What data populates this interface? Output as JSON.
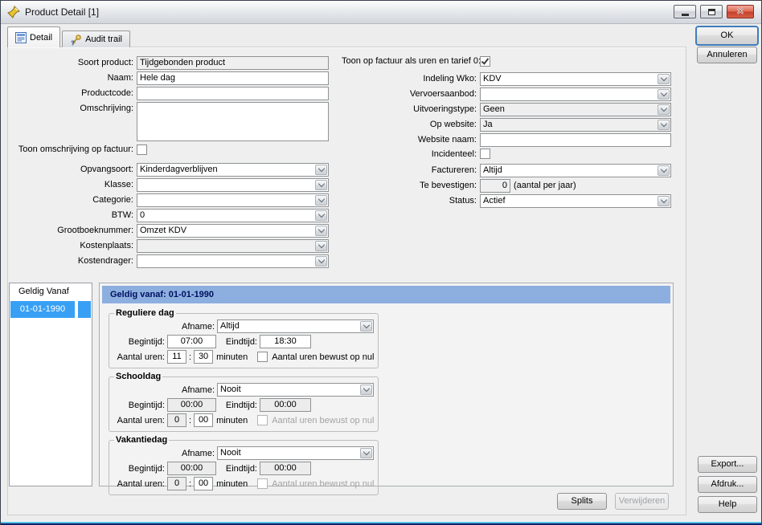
{
  "window": {
    "title": "Product Detail [1]"
  },
  "icons": {
    "titlebar": "pushpin-icon",
    "tab_detail": "document-icon",
    "tab_audit": "audit-key-icon",
    "combo_button": "chevron-down-icon",
    "minimize": "minimize-icon",
    "maximize": "maximize-icon",
    "close": "close-icon"
  },
  "tabs": {
    "detail": "Detail",
    "audit_trail": "Audit trail"
  },
  "buttons": {
    "ok": "OK",
    "annuleren": "Annuleren",
    "export": "Export...",
    "afdruk": "Afdruk...",
    "help": "Help",
    "splits": "Splits",
    "verwijderen": "Verwijderen"
  },
  "form_left": {
    "soort_product": {
      "label": "Soort product:",
      "value": "Tijdgebonden product"
    },
    "naam": {
      "label": "Naam:",
      "value": "Hele dag"
    },
    "productcode": {
      "label": "Productcode:",
      "value": ""
    },
    "omschrijving": {
      "label": "Omschrijving:",
      "value": ""
    },
    "toon_omschrijving": {
      "label": "Toon omschrijving op factuur:",
      "checked": false
    },
    "opvangsoort": {
      "label": "Opvangsoort:",
      "value": "Kinderdagverblijven"
    },
    "klasse": {
      "label": "Klasse:",
      "value": ""
    },
    "categorie": {
      "label": "Categorie:",
      "value": ""
    },
    "btw": {
      "label": "BTW:",
      "value": "0"
    },
    "grootboeknummer": {
      "label": "Grootboeknummer:",
      "value": "Omzet KDV"
    },
    "kostenplaats": {
      "label": "Kostenplaats:",
      "value": ""
    },
    "kostendrager": {
      "label": "Kostendrager:",
      "value": ""
    }
  },
  "form_right": {
    "toon_op_factuur": {
      "label": "Toon op factuur als uren en tarief 0:",
      "checked": true
    },
    "indeling_wko": {
      "label": "Indeling Wko:",
      "value": "KDV"
    },
    "vervoersaanbod": {
      "label": "Vervoersaanbod:",
      "value": ""
    },
    "uitvoeringstype": {
      "label": "Uitvoeringstype:",
      "value": "Geen"
    },
    "op_website": {
      "label": "Op website:",
      "value": "Ja"
    },
    "website_naam": {
      "label": "Website naam:",
      "value": ""
    },
    "incidenteel": {
      "label": "Incidenteel:",
      "checked": false
    },
    "factureren": {
      "label": "Factureren:",
      "value": "Altijd"
    },
    "te_bevestigen": {
      "label": "Te bevestigen:",
      "value": "0",
      "suffix": "(aantal per jaar)"
    },
    "status": {
      "label": "Status:",
      "value": "Actief"
    }
  },
  "validity": {
    "list_header": "Geldig Vanaf",
    "list_items": [
      "01-01-1990"
    ],
    "panel_title": "Geldig vanaf: 01-01-1990",
    "time_separator": ":",
    "groups": [
      {
        "title": "Reguliere dag",
        "afname_label": "Afname:",
        "afname": "Altijd",
        "begintijd_label": "Begintijd:",
        "begintijd": "07:00",
        "eindtijd_label": "Eindtijd:",
        "eindtijd": "18:30",
        "aantal_label": "Aantal uren:",
        "uren": "11",
        "minuten": "30",
        "minuten_label": "minuten",
        "nul_label": "Aantal uren bewust op nul",
        "nul_checked": false,
        "disabled": false
      },
      {
        "title": "Schooldag",
        "afname_label": "Afname:",
        "afname": "Nooit",
        "begintijd_label": "Begintijd:",
        "begintijd": "00:00",
        "eindtijd_label": "Eindtijd:",
        "eindtijd": "00:00",
        "aantal_label": "Aantal uren:",
        "uren": "0",
        "minuten": "00",
        "minuten_label": "minuten",
        "nul_label": "Aantal uren bewust op nul",
        "nul_checked": false,
        "disabled": true
      },
      {
        "title": "Vakantiedag",
        "afname_label": "Afname:",
        "afname": "Nooit",
        "begintijd_label": "Begintijd:",
        "begintijd": "00:00",
        "eindtijd_label": "Eindtijd:",
        "eindtijd": "00:00",
        "aantal_label": "Aantal uren:",
        "uren": "0",
        "minuten": "00",
        "minuten_label": "minuten",
        "nul_label": "Aantal uren bewust op nul",
        "nul_checked": false,
        "disabled": true
      }
    ]
  },
  "colors": {
    "selection": "#38a0f4",
    "panel_header": "#8dafdf",
    "close_button": "#cc4b3c"
  }
}
